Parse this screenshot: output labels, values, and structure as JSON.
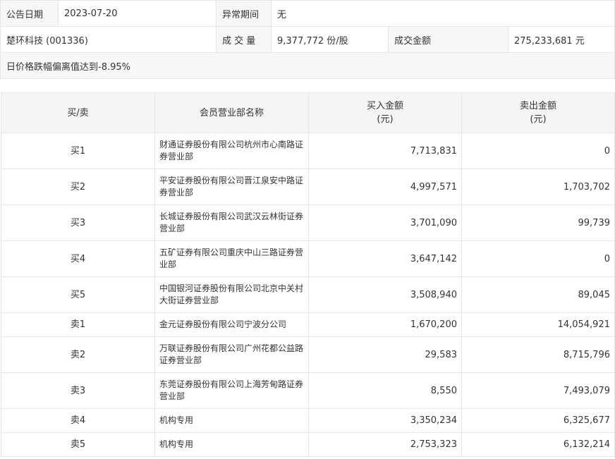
{
  "info": {
    "date_label": "公告日期",
    "date_value": "2023-07-20",
    "period_label": "异常期间",
    "period_value": "无",
    "stock": "楚环科技 (001336)",
    "volume_label": "成 交 量",
    "volume_value": "9,377,772 份/股",
    "amount_label": "成交金额",
    "amount_value": "275,233,681 元",
    "note": "日价格跌幅偏离值达到-8.95%"
  },
  "table": {
    "headers": {
      "side": "买/卖",
      "name": "会员营业部名称",
      "buy_line1": "买入金额",
      "buy_line2": "(元)",
      "sell_line1": "卖出金额",
      "sell_line2": "(元)"
    },
    "rows": [
      {
        "side": "买1",
        "name": "财通证券股份有限公司杭州市心南路证券营业部",
        "buy": "7,713,831",
        "sell": "0"
      },
      {
        "side": "买2",
        "name": "平安证券股份有限公司晋江泉安中路证券营业部",
        "buy": "4,997,571",
        "sell": "1,703,702"
      },
      {
        "side": "买3",
        "name": "长城证券股份有限公司武汉云林街证券营业部",
        "buy": "3,701,090",
        "sell": "99,739"
      },
      {
        "side": "买4",
        "name": "五矿证券有限公司重庆中山三路证券营业部",
        "buy": "3,647,142",
        "sell": "0"
      },
      {
        "side": "买5",
        "name": "中国银河证券股份有限公司北京中关村大街证券营业部",
        "buy": "3,508,940",
        "sell": "89,045"
      },
      {
        "side": "卖1",
        "name": "金元证券股份有限公司宁波分公司",
        "buy": "1,670,200",
        "sell": "14,054,921"
      },
      {
        "side": "卖2",
        "name": "万联证券股份有限公司广州花都公益路证券营业部",
        "buy": "29,583",
        "sell": "8,715,796"
      },
      {
        "side": "卖3",
        "name": "东莞证券股份有限公司上海芳甸路证券营业部",
        "buy": "8,550",
        "sell": "7,493,079"
      },
      {
        "side": "卖4",
        "name": "机构专用",
        "buy": "3,350,234",
        "sell": "6,325,677"
      },
      {
        "side": "卖5",
        "name": "机构专用",
        "buy": "2,753,323",
        "sell": "6,132,214"
      }
    ]
  }
}
